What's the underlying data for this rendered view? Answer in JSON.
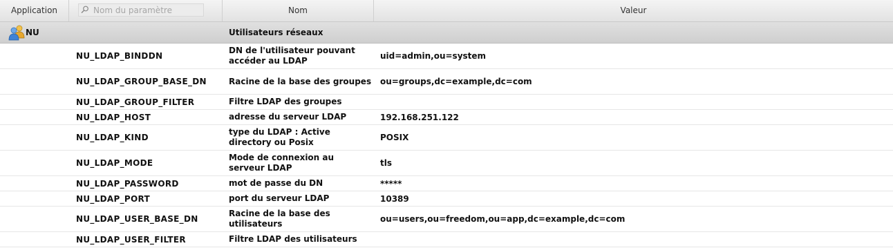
{
  "header": {
    "application_label": "Application",
    "search_placeholder": "Nom du paramètre",
    "nom_label": "Nom",
    "valeur_label": "Valeur"
  },
  "group": {
    "app": "NU",
    "title": "Utilisateurs réseaux",
    "icon": "users-icon"
  },
  "rows": [
    {
      "key": "NU_LDAP_BINDDN",
      "nom": "DN de l'utilisateur pouvant accéder au LDAP",
      "valeur": "uid=admin,ou=system"
    },
    {
      "key": "NU_LDAP_GROUP_BASE_DN",
      "nom": "Racine de la base des groupes",
      "valeur": "ou=groups,dc=example,dc=com"
    },
    {
      "key": "NU_LDAP_GROUP_FILTER",
      "nom": "Filtre LDAP des groupes",
      "valeur": ""
    },
    {
      "key": "NU_LDAP_HOST",
      "nom": "adresse du serveur LDAP",
      "valeur": "192.168.251.122"
    },
    {
      "key": "NU_LDAP_KIND",
      "nom": "type du LDAP : Active directory ou Posix",
      "valeur": "POSIX"
    },
    {
      "key": "NU_LDAP_MODE",
      "nom": "Mode de connexion au serveur LDAP",
      "valeur": "tls"
    },
    {
      "key": "NU_LDAP_PASSWORD",
      "nom": "mot de passe du DN",
      "valeur": "*****"
    },
    {
      "key": "NU_LDAP_PORT",
      "nom": "port du serveur LDAP",
      "valeur": "10389"
    },
    {
      "key": "NU_LDAP_USER_BASE_DN",
      "nom": "Racine de la base des utilisateurs",
      "valeur": "ou=users,ou=freedom,ou=app,dc=example,dc=com"
    },
    {
      "key": "NU_LDAP_USER_FILTER",
      "nom": "Filtre LDAP des utilisateurs",
      "valeur": ""
    }
  ]
}
